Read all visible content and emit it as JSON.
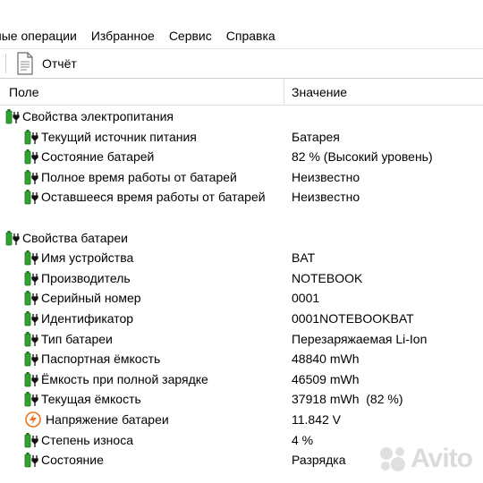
{
  "menu": {
    "items": [
      "ные операции",
      "Избранное",
      "Сервис",
      "Справка"
    ]
  },
  "toolbar": {
    "report_label": "Отчёт",
    "report_icon": "document-icon"
  },
  "columns": {
    "field": "Поле",
    "value": "Значение"
  },
  "sections": [
    {
      "title": "Свойства электропитания",
      "rows": [
        {
          "field": "Текущий источник питания",
          "value": "Батарея",
          "icon": "battery-icon"
        },
        {
          "field": "Состояние батарей",
          "value": "82 % (Высокий уровень)",
          "icon": "battery-icon"
        },
        {
          "field": "Полное время работы от батарей",
          "value": "Неизвестно",
          "icon": "battery-icon"
        },
        {
          "field": "Оставшееся время работы от батарей",
          "value": "Неизвестно",
          "icon": "battery-icon"
        }
      ]
    },
    {
      "title": "Свойства батареи",
      "rows": [
        {
          "field": "Имя устройства",
          "value": "BAT",
          "icon": "battery-icon"
        },
        {
          "field": "Производитель",
          "value": "NOTEBOOK",
          "icon": "battery-icon"
        },
        {
          "field": "Серийный номер",
          "value": "0001",
          "icon": "battery-icon"
        },
        {
          "field": "Идентификатор",
          "value": "0001NOTEBOOKBAT",
          "icon": "battery-icon"
        },
        {
          "field": "Тип батареи",
          "value": "Перезаряжаемая Li-Ion",
          "icon": "battery-icon"
        },
        {
          "field": "Паспортная ёмкость",
          "value": "48840 mWh",
          "icon": "battery-icon"
        },
        {
          "field": "Ёмкость при полной зарядке",
          "value": "46509 mWh",
          "icon": "battery-icon"
        },
        {
          "field": "Текущая ёмкость",
          "value": "37918 mWh  (82 %)",
          "icon": "battery-icon"
        },
        {
          "field": "Напряжение батареи",
          "value": "11.842 V",
          "icon": "voltage-icon"
        },
        {
          "field": "Степень износа",
          "value": "4 %",
          "icon": "battery-icon"
        },
        {
          "field": "Состояние",
          "value": "Разрядка",
          "icon": "battery-icon"
        }
      ]
    }
  ],
  "watermark": {
    "text": "Avito"
  },
  "colors": {
    "battery_green": "#2fa52f",
    "voltage_orange": "#e8731a"
  }
}
